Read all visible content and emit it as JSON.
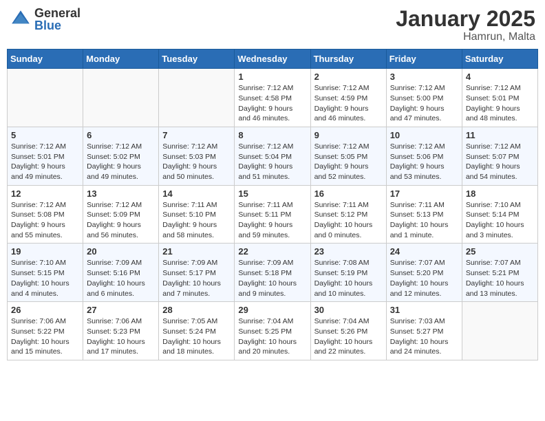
{
  "header": {
    "logo_general": "General",
    "logo_blue": "Blue",
    "month": "January 2025",
    "location": "Hamrun, Malta"
  },
  "weekdays": [
    "Sunday",
    "Monday",
    "Tuesday",
    "Wednesday",
    "Thursday",
    "Friday",
    "Saturday"
  ],
  "weeks": [
    [
      {
        "day": "",
        "info": ""
      },
      {
        "day": "",
        "info": ""
      },
      {
        "day": "",
        "info": ""
      },
      {
        "day": "1",
        "info": "Sunrise: 7:12 AM\nSunset: 4:58 PM\nDaylight: 9 hours and 46 minutes."
      },
      {
        "day": "2",
        "info": "Sunrise: 7:12 AM\nSunset: 4:59 PM\nDaylight: 9 hours and 46 minutes."
      },
      {
        "day": "3",
        "info": "Sunrise: 7:12 AM\nSunset: 5:00 PM\nDaylight: 9 hours and 47 minutes."
      },
      {
        "day": "4",
        "info": "Sunrise: 7:12 AM\nSunset: 5:01 PM\nDaylight: 9 hours and 48 minutes."
      }
    ],
    [
      {
        "day": "5",
        "info": "Sunrise: 7:12 AM\nSunset: 5:01 PM\nDaylight: 9 hours and 49 minutes."
      },
      {
        "day": "6",
        "info": "Sunrise: 7:12 AM\nSunset: 5:02 PM\nDaylight: 9 hours and 49 minutes."
      },
      {
        "day": "7",
        "info": "Sunrise: 7:12 AM\nSunset: 5:03 PM\nDaylight: 9 hours and 50 minutes."
      },
      {
        "day": "8",
        "info": "Sunrise: 7:12 AM\nSunset: 5:04 PM\nDaylight: 9 hours and 51 minutes."
      },
      {
        "day": "9",
        "info": "Sunrise: 7:12 AM\nSunset: 5:05 PM\nDaylight: 9 hours and 52 minutes."
      },
      {
        "day": "10",
        "info": "Sunrise: 7:12 AM\nSunset: 5:06 PM\nDaylight: 9 hours and 53 minutes."
      },
      {
        "day": "11",
        "info": "Sunrise: 7:12 AM\nSunset: 5:07 PM\nDaylight: 9 hours and 54 minutes."
      }
    ],
    [
      {
        "day": "12",
        "info": "Sunrise: 7:12 AM\nSunset: 5:08 PM\nDaylight: 9 hours and 55 minutes."
      },
      {
        "day": "13",
        "info": "Sunrise: 7:12 AM\nSunset: 5:09 PM\nDaylight: 9 hours and 56 minutes."
      },
      {
        "day": "14",
        "info": "Sunrise: 7:11 AM\nSunset: 5:10 PM\nDaylight: 9 hours and 58 minutes."
      },
      {
        "day": "15",
        "info": "Sunrise: 7:11 AM\nSunset: 5:11 PM\nDaylight: 9 hours and 59 minutes."
      },
      {
        "day": "16",
        "info": "Sunrise: 7:11 AM\nSunset: 5:12 PM\nDaylight: 10 hours and 0 minutes."
      },
      {
        "day": "17",
        "info": "Sunrise: 7:11 AM\nSunset: 5:13 PM\nDaylight: 10 hours and 1 minute."
      },
      {
        "day": "18",
        "info": "Sunrise: 7:10 AM\nSunset: 5:14 PM\nDaylight: 10 hours and 3 minutes."
      }
    ],
    [
      {
        "day": "19",
        "info": "Sunrise: 7:10 AM\nSunset: 5:15 PM\nDaylight: 10 hours and 4 minutes."
      },
      {
        "day": "20",
        "info": "Sunrise: 7:09 AM\nSunset: 5:16 PM\nDaylight: 10 hours and 6 minutes."
      },
      {
        "day": "21",
        "info": "Sunrise: 7:09 AM\nSunset: 5:17 PM\nDaylight: 10 hours and 7 minutes."
      },
      {
        "day": "22",
        "info": "Sunrise: 7:09 AM\nSunset: 5:18 PM\nDaylight: 10 hours and 9 minutes."
      },
      {
        "day": "23",
        "info": "Sunrise: 7:08 AM\nSunset: 5:19 PM\nDaylight: 10 hours and 10 minutes."
      },
      {
        "day": "24",
        "info": "Sunrise: 7:07 AM\nSunset: 5:20 PM\nDaylight: 10 hours and 12 minutes."
      },
      {
        "day": "25",
        "info": "Sunrise: 7:07 AM\nSunset: 5:21 PM\nDaylight: 10 hours and 13 minutes."
      }
    ],
    [
      {
        "day": "26",
        "info": "Sunrise: 7:06 AM\nSunset: 5:22 PM\nDaylight: 10 hours and 15 minutes."
      },
      {
        "day": "27",
        "info": "Sunrise: 7:06 AM\nSunset: 5:23 PM\nDaylight: 10 hours and 17 minutes."
      },
      {
        "day": "28",
        "info": "Sunrise: 7:05 AM\nSunset: 5:24 PM\nDaylight: 10 hours and 18 minutes."
      },
      {
        "day": "29",
        "info": "Sunrise: 7:04 AM\nSunset: 5:25 PM\nDaylight: 10 hours and 20 minutes."
      },
      {
        "day": "30",
        "info": "Sunrise: 7:04 AM\nSunset: 5:26 PM\nDaylight: 10 hours and 22 minutes."
      },
      {
        "day": "31",
        "info": "Sunrise: 7:03 AM\nSunset: 5:27 PM\nDaylight: 10 hours and 24 minutes."
      },
      {
        "day": "",
        "info": ""
      }
    ]
  ]
}
